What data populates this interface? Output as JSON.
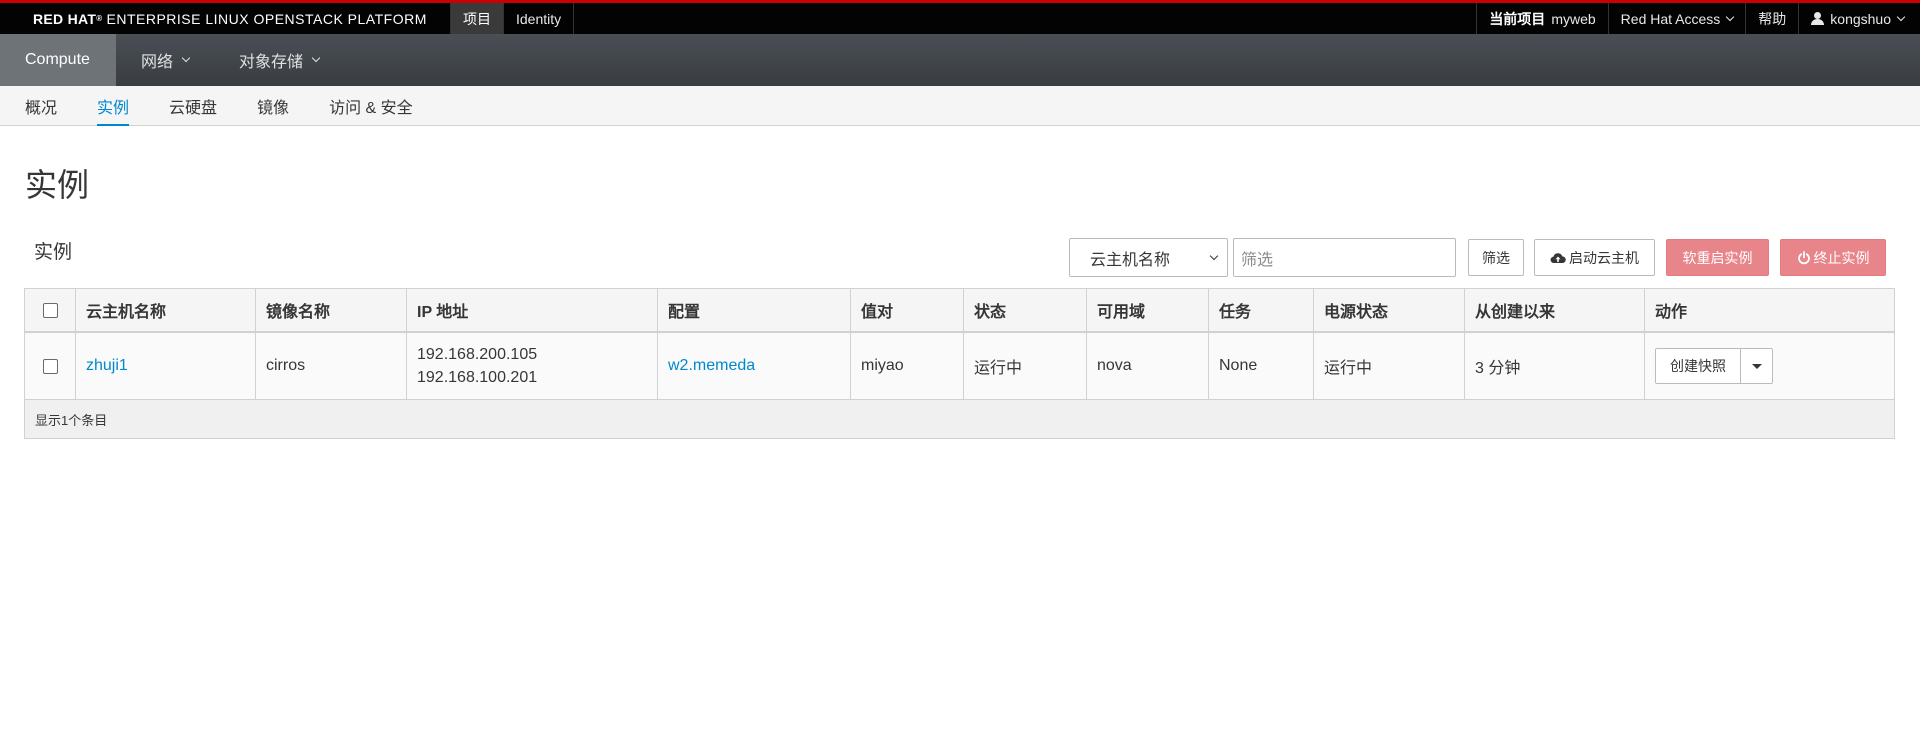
{
  "brand": {
    "name": "RED HAT",
    "product": "ENTERPRISE LINUX OPENSTACK PLATFORM"
  },
  "top_tabs": [
    {
      "label": "项目",
      "active": true
    },
    {
      "label": "Identity",
      "active": false
    }
  ],
  "top_right": {
    "current_project_label": "当前项目",
    "current_project_value": "myweb",
    "access_label": "Red Hat Access",
    "help_label": "帮助",
    "user_label": "kongshuo"
  },
  "main_nav": {
    "compute": "Compute",
    "network": "网络",
    "object_storage": "对象存储"
  },
  "sub_nav": {
    "overview": "概况",
    "instances": "实例",
    "volumes": "云硬盘",
    "images": "镜像",
    "access_security": "访问 & 安全"
  },
  "page": {
    "title": "实例"
  },
  "table": {
    "caption": "实例",
    "filter_select": "云主机名称",
    "filter_placeholder": "筛选",
    "filter_button": "筛选",
    "launch_button": "启动云主机",
    "soft_reboot_button": "软重启实例",
    "terminate_button": "终止实例",
    "headers": [
      "云主机名称",
      "镜像名称",
      "IP 地址",
      "配置",
      "值对",
      "状态",
      "可用域",
      "任务",
      "电源状态",
      "从创建以来",
      "动作"
    ],
    "rows": [
      {
        "name": "zhuji1",
        "image": "cirros",
        "ip1": "192.168.200.105",
        "ip2": "192.168.100.201",
        "flavor": "w2.memeda",
        "keypair": "miyao",
        "status": "运行中",
        "zone": "nova",
        "task": "None",
        "power": "运行中",
        "age": "3 分钟",
        "action": "创建快照"
      }
    ],
    "footer": "显示1个条目"
  },
  "colors": {
    "accent": "#0088ce",
    "danger": "#e8858a",
    "topbar": "#030303",
    "brand_red": "#cc0000"
  }
}
